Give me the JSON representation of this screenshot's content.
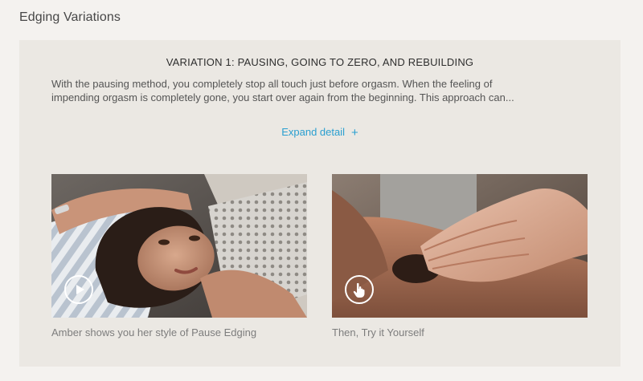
{
  "section": {
    "title": "Edging Variations"
  },
  "variation": {
    "title": "VARIATION 1: PAUSING, GOING TO ZERO, AND REBUILDING",
    "description_line1": "With the pausing method, you completely stop all touch just before orgasm. When the feeling of",
    "description_line2": "impending orgasm is completely gone, you start over again from the beginning. This approach can...",
    "expand_label": "Expand detail",
    "expand_icon": "+"
  },
  "cards": [
    {
      "caption": "Amber shows you her style of Pause Edging",
      "icon": "play-icon"
    },
    {
      "caption": "Then, Try it Yourself",
      "icon": "hand-pointer-icon"
    }
  ],
  "colors": {
    "accent": "#2a9fd0",
    "panel_bg": "#ebe8e3",
    "page_bg": "#f4f2ef"
  }
}
